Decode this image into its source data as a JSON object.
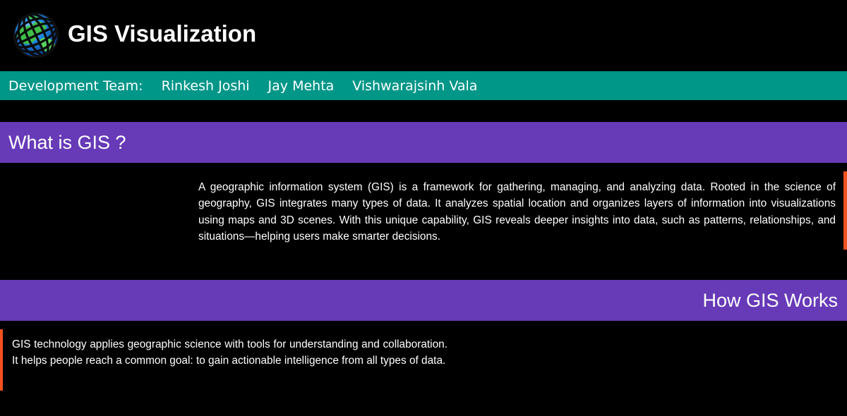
{
  "header": {
    "title": "GIS Visualization",
    "logo_icon": "globe-icon"
  },
  "team": {
    "label": "Development Team:",
    "members": [
      "Rinkesh Joshi",
      "Jay Mehta",
      "Vishwarajsinh Vala"
    ]
  },
  "sections": [
    {
      "heading": "What is GIS ?",
      "body": "A geographic information system (GIS) is a framework for gathering, managing, and analyzing data. Rooted in the science of geography, GIS integrates many types of data. It analyzes spatial location and organizes layers of information into visualizations using maps and 3D scenes. With this unique capability, GIS reveals deeper insights into data, such as patterns, relationships, and situations—helping users make smarter decisions."
    },
    {
      "heading": "How GIS Works",
      "body": "GIS technology applies geographic science with tools for understanding and collaboration. It helps people reach a common goal: to gain actionable intelligence from all types of data."
    }
  ],
  "colors": {
    "background": "#000000",
    "team_bar": "#009688",
    "section_heading": "#673ab7",
    "accent_bar": "#f4511e",
    "text": "#ffffff"
  }
}
